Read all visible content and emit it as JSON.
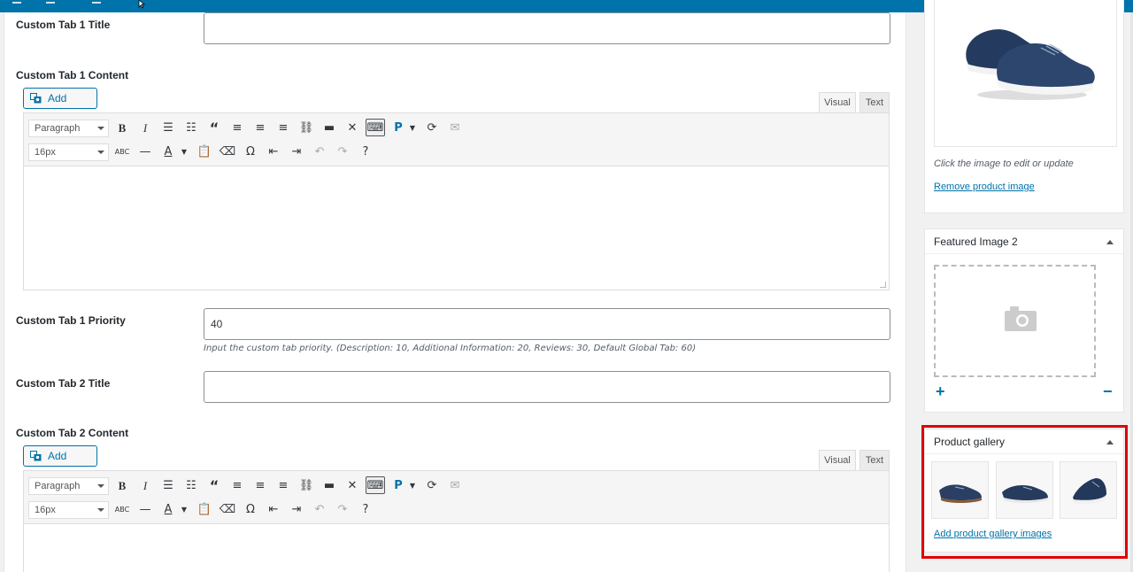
{
  "admin_bar": {
    "color": "#0073aa"
  },
  "tab1": {
    "title_label": "Custom Tab 1 Title",
    "title_value": "",
    "content_label": "Custom Tab 1 Content",
    "priority_label": "Custom Tab 1 Priority",
    "priority_value": "40",
    "priority_hint": "Input the custom tab priority. (Description: 10, Additional Information: 20, Reviews: 30, Default Global Tab: 60)"
  },
  "tab2": {
    "title_label": "Custom Tab 2 Title",
    "title_value": "",
    "content_label": "Custom Tab 2 Content"
  },
  "editor": {
    "add_media": "Add Media",
    "tab_visual": "Visual",
    "tab_text": "Text",
    "format_select": "Paragraph",
    "size_select": "16px",
    "row1_icons": [
      "bold-icon",
      "italic-icon",
      "bullet-list-icon",
      "numbered-list-icon",
      "blockquote-icon",
      "align-left-icon",
      "align-center-icon",
      "align-right-icon",
      "link-icon",
      "read-more-icon",
      "fullscreen-icon",
      "toolbar-toggle-icon",
      "p-dropdown-icon",
      "refresh-icon",
      "mail-icon"
    ],
    "row2_icons": [
      "abc-strikethrough-icon",
      "horizontal-line-icon",
      "text-color-icon",
      "paste-text-icon",
      "clear-format-icon",
      "omega-icon",
      "outdent-icon",
      "indent-icon",
      "undo-icon",
      "redo-icon",
      "help-icon"
    ]
  },
  "sidebar": {
    "product_image": {
      "hint": "Click the image to edit or update",
      "remove_link": "Remove product image"
    },
    "featured_image_2": {
      "title": "Featured Image 2",
      "plus": "+",
      "minus": "−"
    },
    "product_gallery": {
      "title": "Product gallery",
      "add_link": "Add product gallery images",
      "images": [
        "shoe-image-1",
        "shoe-image-2",
        "shoe-image-3"
      ]
    }
  },
  "colors": {
    "accent": "#0073aa",
    "highlight": "#e00000"
  }
}
